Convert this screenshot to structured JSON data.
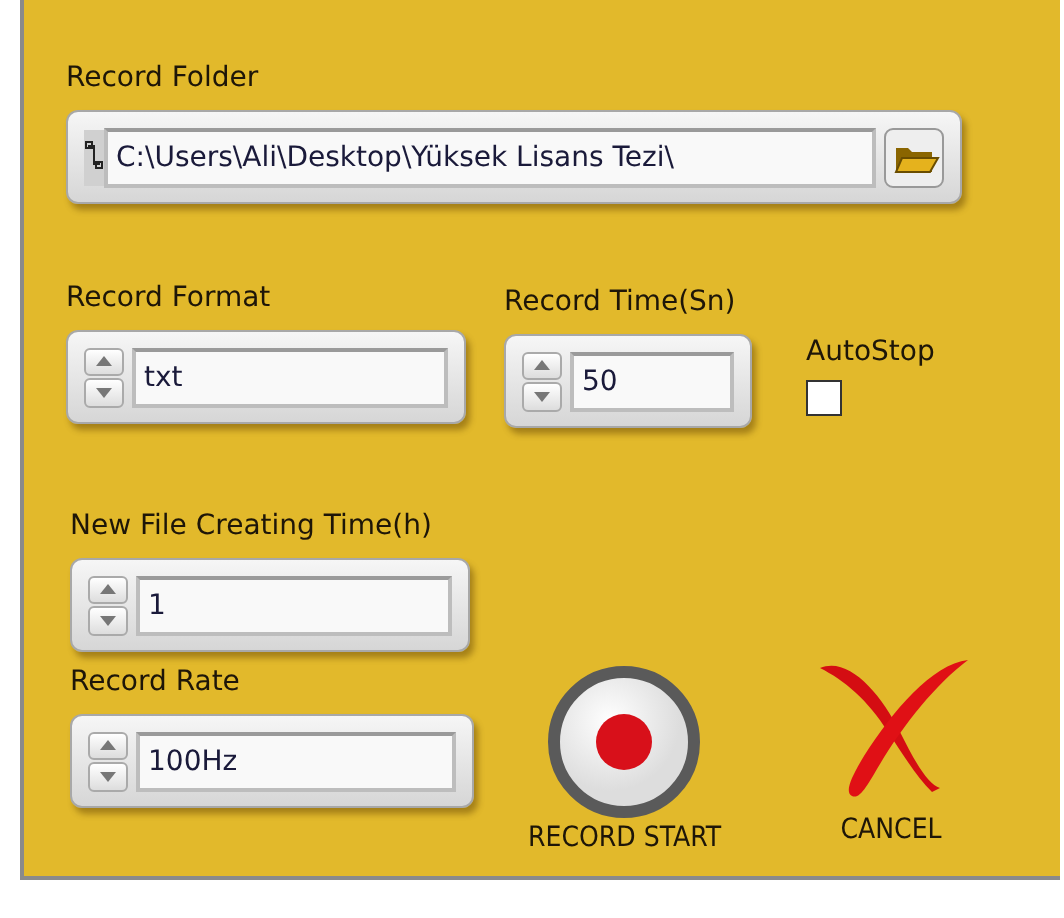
{
  "record_folder": {
    "label": "Record Folder",
    "value": "C:\\Users\\Ali\\Desktop\\Yüksek Lisans Tezi\\"
  },
  "record_format": {
    "label": "Record Format",
    "value": "txt"
  },
  "record_time": {
    "label": "Record Time(Sn)",
    "value": "50"
  },
  "autostop": {
    "label": "AutoStop",
    "checked": false
  },
  "new_file_time": {
    "label": "New File Creating Time(h)",
    "value": "1"
  },
  "record_rate": {
    "label": "Record Rate",
    "value": "100Hz"
  },
  "buttons": [
    {
      "kind": "record",
      "label": "RECORD START"
    },
    {
      "kind": "cancel",
      "label": "CANCEL"
    }
  ]
}
